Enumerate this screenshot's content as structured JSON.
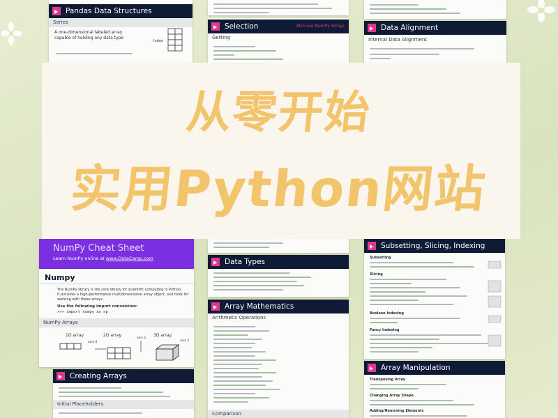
{
  "headline": {
    "line1": "从零开始",
    "line2": "实用Python网站"
  },
  "colors": {
    "background": "#dfe7c6",
    "header": "#0f1a35",
    "accent_pink": "#e0398c",
    "purple": "#7b2fe0",
    "headline": "#f2c46b"
  },
  "cards": {
    "pandas": {
      "title": "Pandas Data Structures",
      "series": "Series",
      "desc1": "A one-dimensional labeled array",
      "desc2": "capable of holding any data type",
      "index": "Index"
    },
    "selection": {
      "title": "Selection",
      "link": "Also see NumPy Arrays",
      "getting": "Getting"
    },
    "alignment": {
      "title": "Data Alignment",
      "sub": "Internal Data Alignment"
    },
    "numpy": {
      "banner_title": "NumPy Cheat Sheet",
      "banner_link_prefix": "Learn NumPy online at ",
      "banner_link": "www.DataCamp.com",
      "title": "Numpy",
      "desc1": "The NumPy library is the core library for scientific computing in Python.",
      "desc2": "It provides a high-performance multidimensional array object, and tools for",
      "desc3": "working with these arrays.",
      "conv": "Use the following import convention:",
      "import": ">>> import numpy as np",
      "arrays_sub": "NumPy Arrays",
      "arr1": "1D array",
      "arr2": "2D array",
      "arr3": "3D array",
      "axis0": "axis 0",
      "axis1": "axis 1",
      "axis2": "axis 2"
    },
    "creating": {
      "title": "Creating Arrays",
      "sub": "Initial Placeholders"
    },
    "datatypes": {
      "title": "Data Types"
    },
    "arraymath": {
      "title": "Array Mathematics",
      "sub": "Arithmetic Operations",
      "comparison": "Comparison"
    },
    "subsetting": {
      "title": "Subsetting, Slicing, Indexing",
      "subsetting": "Subsetting",
      "slicing": "Slicing",
      "boolean": "Boolean Indexing",
      "fancy": "Fancy Indexing"
    },
    "manipulation": {
      "title": "Array Manipulation",
      "transposing": "Transposing Array",
      "changing": "Changing Array Shape",
      "adding": "Adding/Removing Elements"
    }
  }
}
